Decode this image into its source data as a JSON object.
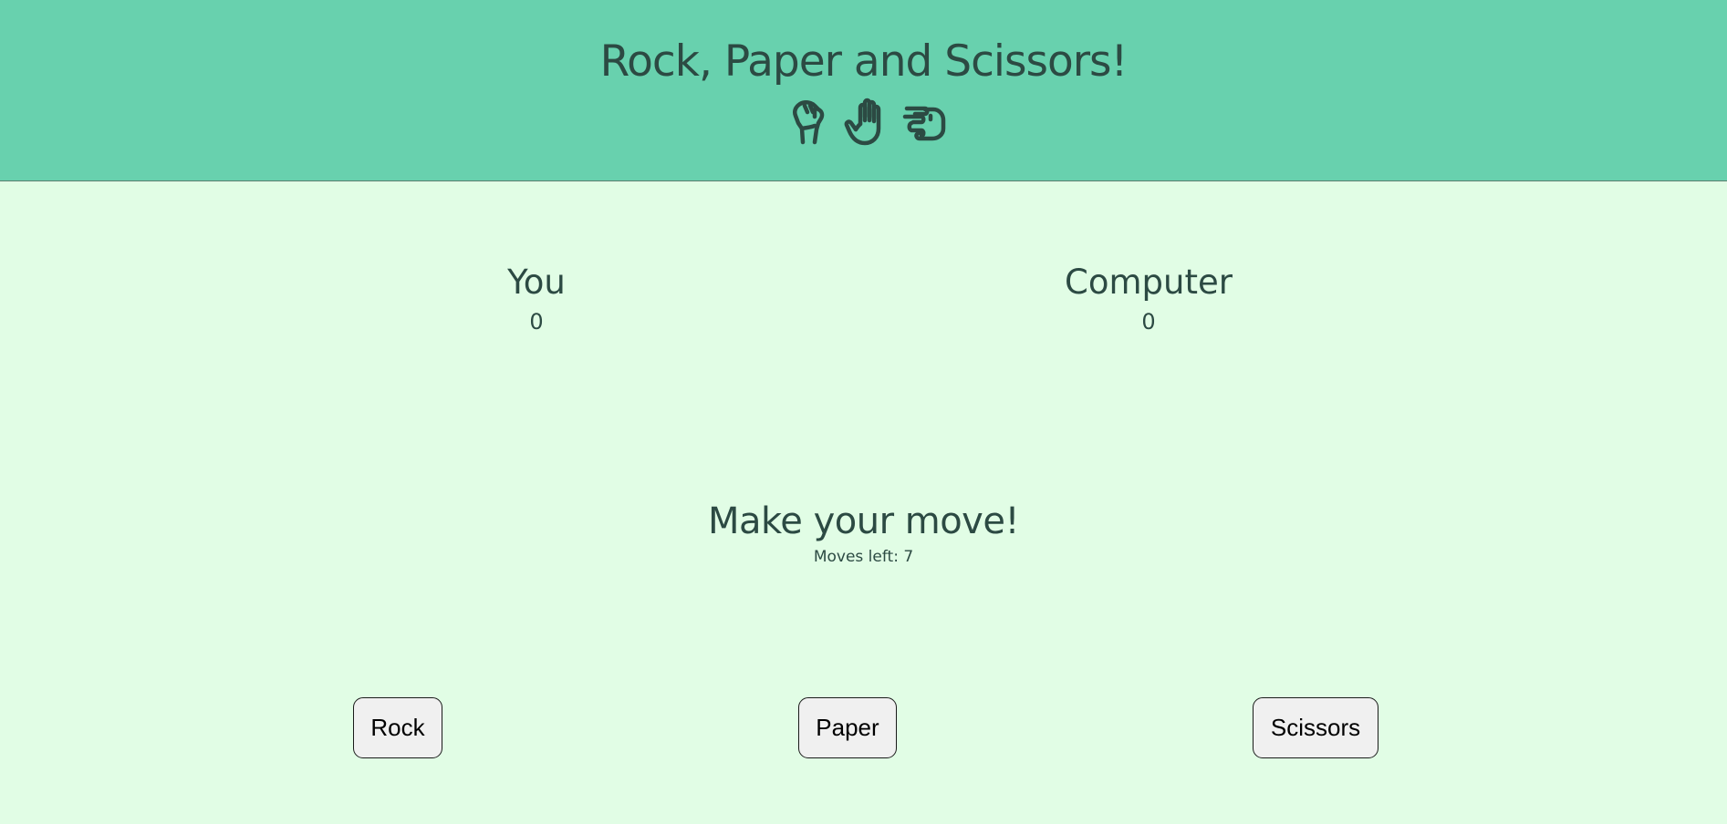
{
  "header": {
    "title": "Rock, Paper and Scissors!",
    "icons": [
      "rock-hand-icon",
      "paper-hand-icon",
      "scissors-hand-icon"
    ]
  },
  "scoreboard": {
    "player_label": "You",
    "player_score": "0",
    "computer_label": "Computer",
    "computer_score": "0"
  },
  "status": {
    "message": "Make your move!",
    "moves_left": "Moves left: 7"
  },
  "controls": {
    "rock_label": "Rock",
    "paper_label": "Paper",
    "scissors_label": "Scissors"
  },
  "colors": {
    "header_bg": "#68d1ae",
    "page_bg": "#e1fde5",
    "text": "#2c4a43",
    "button_bg": "#f0f0f0"
  }
}
